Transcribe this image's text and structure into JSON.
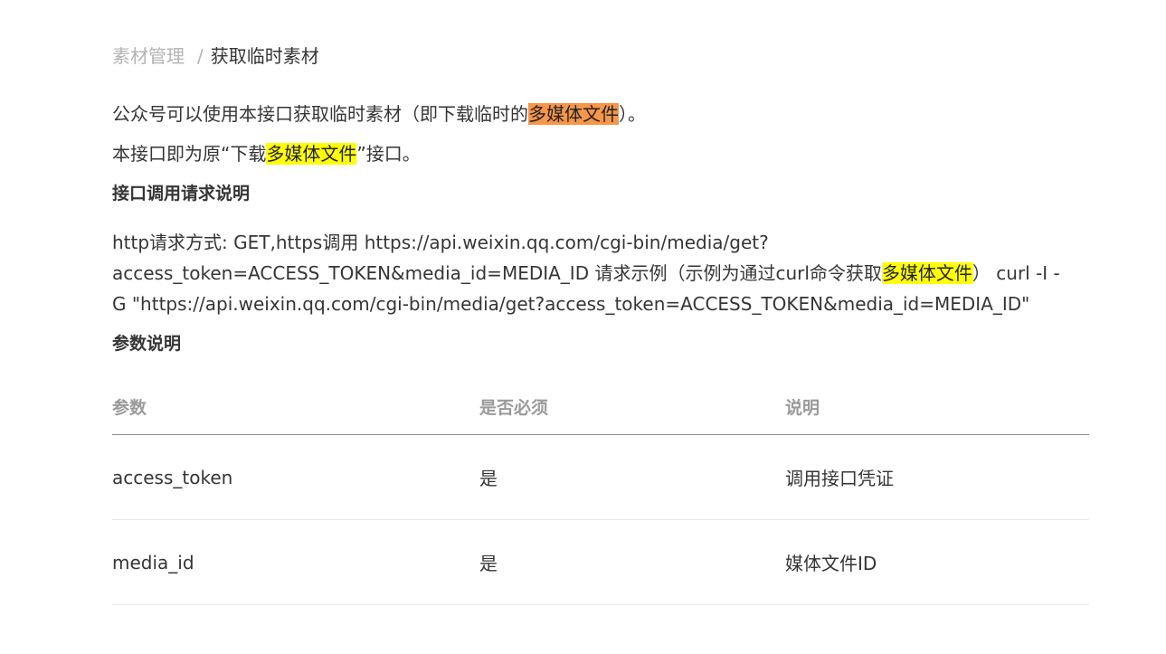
{
  "breadcrumb": {
    "parent": "素材管理",
    "separator": "/",
    "current": "获取临时素材"
  },
  "intro": {
    "line1_before": "公众号可以使用本接口获取临时素材（即下载临时的",
    "line1_highlight": "多媒体文件",
    "line1_after": "）。",
    "line2_before": "本接口即为原“下载",
    "line2_highlight": "多媒体文件",
    "line2_after": "”接口。"
  },
  "request_section": {
    "heading": "接口调用请求说明",
    "line1": "http请求方式: GET,https调用 https://api.weixin.qq.com/cgi-bin/media/get?",
    "line2_before": "access_token=ACCESS_TOKEN&media_id=MEDIA_ID 请求示例（示例为通过curl命令获取",
    "line2_highlight": "多媒体文件",
    "line2_after": "） curl -I -",
    "line3": "G \"https://api.weixin.qq.com/cgi-bin/media/get?access_token=ACCESS_TOKEN&media_id=MEDIA_ID\""
  },
  "params_section": {
    "heading": "参数说明",
    "columns": [
      "参数",
      "是否必须",
      "说明"
    ],
    "rows": [
      [
        "access_token",
        "是",
        "调用接口凭证"
      ],
      [
        "media_id",
        "是",
        "媒体文件ID"
      ]
    ]
  },
  "colors": {
    "highlight_orange": "#f79646",
    "highlight_yellow": "#ffff00",
    "text": "#353535",
    "muted": "#b3b3b3"
  }
}
